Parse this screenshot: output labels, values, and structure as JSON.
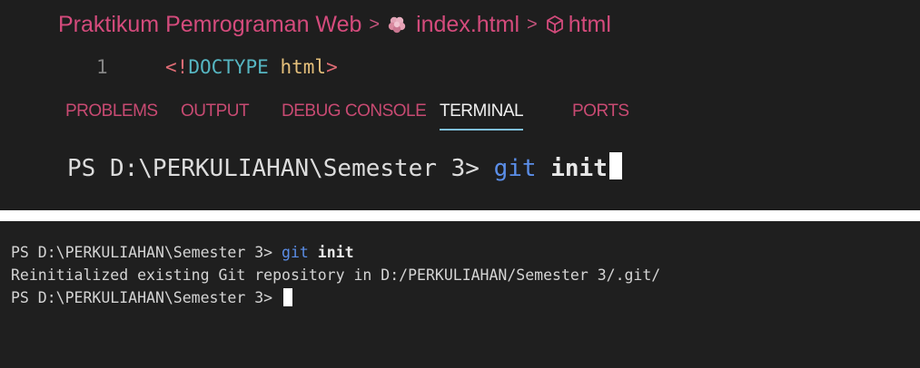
{
  "top": {
    "breadcrumb": {
      "folder": "Praktikum Pemrograman Web",
      "separator": ">",
      "file": "index.html",
      "symbol": "html"
    },
    "editor": {
      "line_number": "1",
      "tokens": {
        "open": "<",
        "excl": "!",
        "doctype": "DOCTYPE",
        "html": "html",
        "close": ">"
      }
    },
    "tabs": [
      {
        "label": "PROBLEMS",
        "active": false
      },
      {
        "label": "OUTPUT",
        "active": false
      },
      {
        "label": "DEBUG CONSOLE",
        "active": false
      },
      {
        "label": "TERMINAL",
        "active": true
      },
      {
        "label": "PORTS",
        "active": false
      }
    ],
    "terminal": {
      "prompt": "PS D:\\PERKULIAHAN\\Semester 3> ",
      "command": "git",
      "argument": "init"
    }
  },
  "bottom": {
    "terminal": {
      "line1_prompt": "PS D:\\PERKULIAHAN\\Semester 3> ",
      "line1_command": "git",
      "line1_argument": "init",
      "line2_output": "Reinitialized existing Git repository in D:/PERKULIAHAN/Semester 3/.git/",
      "line3_prompt": "PS D:\\PERKULIAHAN\\Semester 3> "
    }
  },
  "colors": {
    "editor_bg": "#1e1e1e",
    "accent_pink": "#d44b7c",
    "git_command_blue": "#5b8ee8",
    "tab_underline": "#7fbfd9"
  },
  "icons": {
    "file": "html-file-icon",
    "symbol": "cube-icon"
  }
}
